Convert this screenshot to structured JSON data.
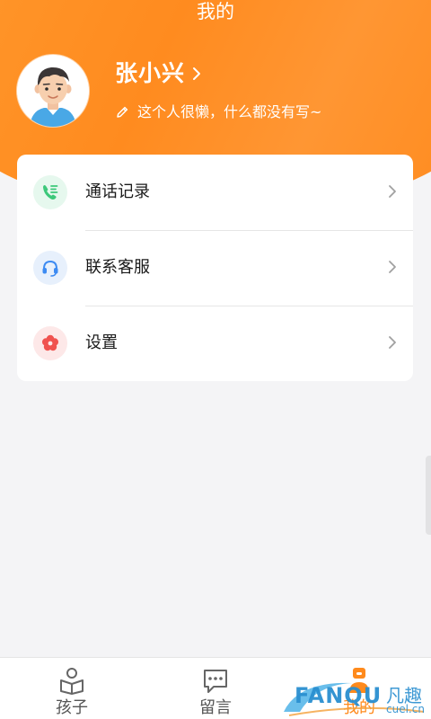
{
  "header": {
    "title": "我的"
  },
  "profile": {
    "name": "张小兴",
    "bio": "这个人很懒，什么都没有写~",
    "avatar_icon": "user-avatar-icon"
  },
  "menu": {
    "items": [
      {
        "label": "通话记录",
        "icon": "phone-log-icon",
        "icon_color": "#3cc87a",
        "icon_bg": "#e6f8ee"
      },
      {
        "label": "联系客服",
        "icon": "headset-icon",
        "icon_color": "#3d8bf2",
        "icon_bg": "#e7f0fc"
      },
      {
        "label": "设置",
        "icon": "settings-flower-icon",
        "icon_color": "#f0524f",
        "icon_bg": "#fde8e8"
      }
    ]
  },
  "tabbar": {
    "tabs": [
      {
        "label": "孩子",
        "icon": "child-book-icon",
        "active": false
      },
      {
        "label": "留言",
        "icon": "message-icon",
        "active": false
      },
      {
        "label": "我的",
        "icon": "me-icon",
        "active": true
      }
    ]
  },
  "watermark": {
    "brand": "FANQU",
    "cn": "凡趣",
    "domain": "cuel.cn"
  },
  "colors": {
    "accent": "#ff8a1c",
    "background": "#f4f4f6"
  }
}
